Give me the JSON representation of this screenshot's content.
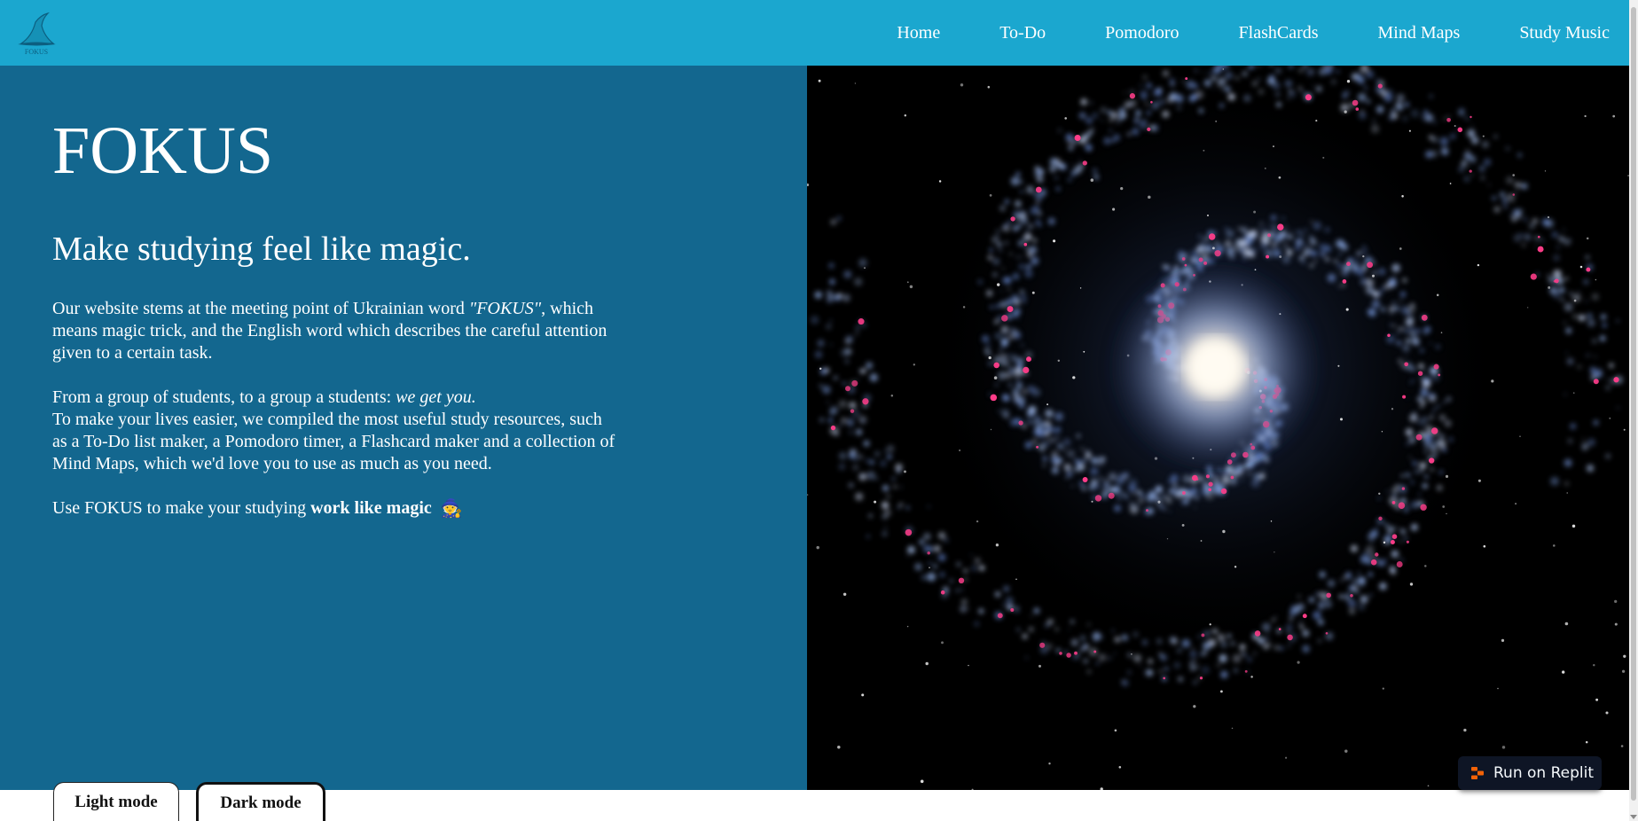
{
  "nav": {
    "logo_text": "FOKUS",
    "links": [
      "Home",
      "To-Do",
      "Pomodoro",
      "FlashCards",
      "Mind Maps",
      "Study Music"
    ]
  },
  "hero": {
    "title": "FOKUS",
    "tagline": "Make studying feel like magic.",
    "para1_before": "Our website stems at the meeting point of Ukrainian word ",
    "para1_quote": "\"FOKUS\"",
    "para1_after": ", which means magic trick, and the English word which describes the careful attention given to a certain task.",
    "para2_before": "From a group of students, to a group a students: ",
    "para2_emphasis": "we get you.",
    "para3": "To make your lives easier, we compiled the most useful study resources, such as a To-Do list maker, a Pomodoro timer, a Flashcard maker and a collection of Mind Maps, which we'd love you to use as much as you need.",
    "para4_before": "Use FOKUS to make your studying ",
    "para4_strong": "work like magic",
    "para4_emoji": "🧙"
  },
  "badge": {
    "label": "Run on Replit"
  },
  "modes": {
    "light": "Light mode",
    "dark": "Dark mode"
  },
  "colors": {
    "nav_bg": "#1ba7cf",
    "hero_bg": "#13678f",
    "badge_bg": "#0e1525",
    "replit_orange": "#f26207"
  },
  "icons": {
    "logo": "wizard-hat-icon",
    "badge": "replit-icon",
    "emoji": "wizard-emoji-icon"
  }
}
